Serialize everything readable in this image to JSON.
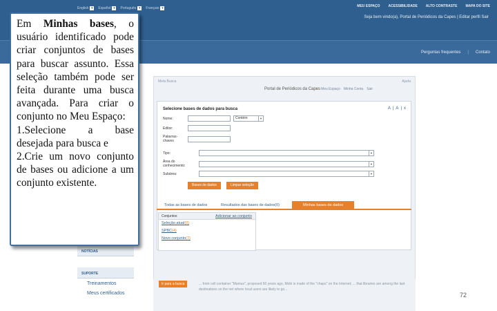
{
  "header": {
    "languages": [
      {
        "label": "English",
        "indicator": "▾"
      },
      {
        "label": "Español",
        "indicator": "▾"
      },
      {
        "label": "Português",
        "indicator": "▾"
      },
      {
        "label": "Français",
        "indicator": "▾"
      }
    ],
    "links": [
      "MEU ESPAÇO",
      "ACESSIBILIDADE",
      "ALTO CONTRASTE",
      "MAPA DO SITE"
    ],
    "welcome": "Seja bem vindo(a), Portal de Periódicos da Capes | Editar perfil  Sair",
    "logo_fragment": "os"
  },
  "navbar": {
    "items": [
      "Perguntas frequentes",
      "Contato"
    ]
  },
  "main": {
    "breadcrumb": "Meta Busca",
    "help": "Ajuda",
    "portal_title": "Portal de Periódicos da Capes",
    "sub_links": [
      "Meu Espaço",
      "Minha Conta",
      "Sair"
    ]
  },
  "dialog": {
    "title": "Selecione bases de dados para busca",
    "controls": [
      "A",
      "|",
      "A",
      "|",
      "x"
    ],
    "fields": {
      "nome_label": "Nome:",
      "match_select": "Contém",
      "editor_label": "Editor:",
      "keywords_label": "Palavras-chaves",
      "tipo_label": "Tipo:",
      "area_label": "Área do conhecimento:",
      "subarea_label": "Subárea:"
    },
    "buttons": {
      "search": "Bases de dados",
      "clear": "Limpar seleção"
    }
  },
  "tabs": [
    {
      "label": "Todas as bases de dados",
      "active": false
    },
    {
      "label": "Resultados das bases de dados(0)",
      "active": false
    },
    {
      "label": "Minhas bases de dados",
      "active": true
    }
  ],
  "results": {
    "header": "Conjuntos",
    "add_link": "Adicionar ao conjunto",
    "items": [
      {
        "name": "Seleção atual",
        "count": "(0)"
      },
      {
        "name": "SPBC",
        "count": "(4)"
      },
      {
        "name": "Novo conjunto",
        "count": "(7)"
      }
    ]
  },
  "sidebar": {
    "headers": [
      "NOTÍCIAS",
      "SUPORTE"
    ],
    "items": [
      "Treinamentos",
      "Meus certificados"
    ]
  },
  "bottom": {
    "button": "Ir para a busca",
    "text": "... from cell container \"Mumus\", proposed 60 years ago, Mobi is made of the \"chaps\" on the Internet; ... that libraries are among the last destinations on the net where local users are likely to go..."
  },
  "callout": {
    "text_before_bold": "Em ",
    "bold": "Minhas bases",
    "text_after_bold": ", o usuário identificado pode criar conjuntos de bases para buscar assunto. Essa seleção também pode ser feita durante uma busca avançada. Para criar o conjunto no Meu Espaço:",
    "step1": "1.Selecione a base desejada para busca e",
    "step2": "2.Crie um novo conjunto de bases ou adicione a um conjunto existente."
  },
  "page_number": "72",
  "colors": {
    "header_blue": "#2f5f8f",
    "accent_orange": "#e6802b",
    "callout_border": "#3d6fa0"
  }
}
